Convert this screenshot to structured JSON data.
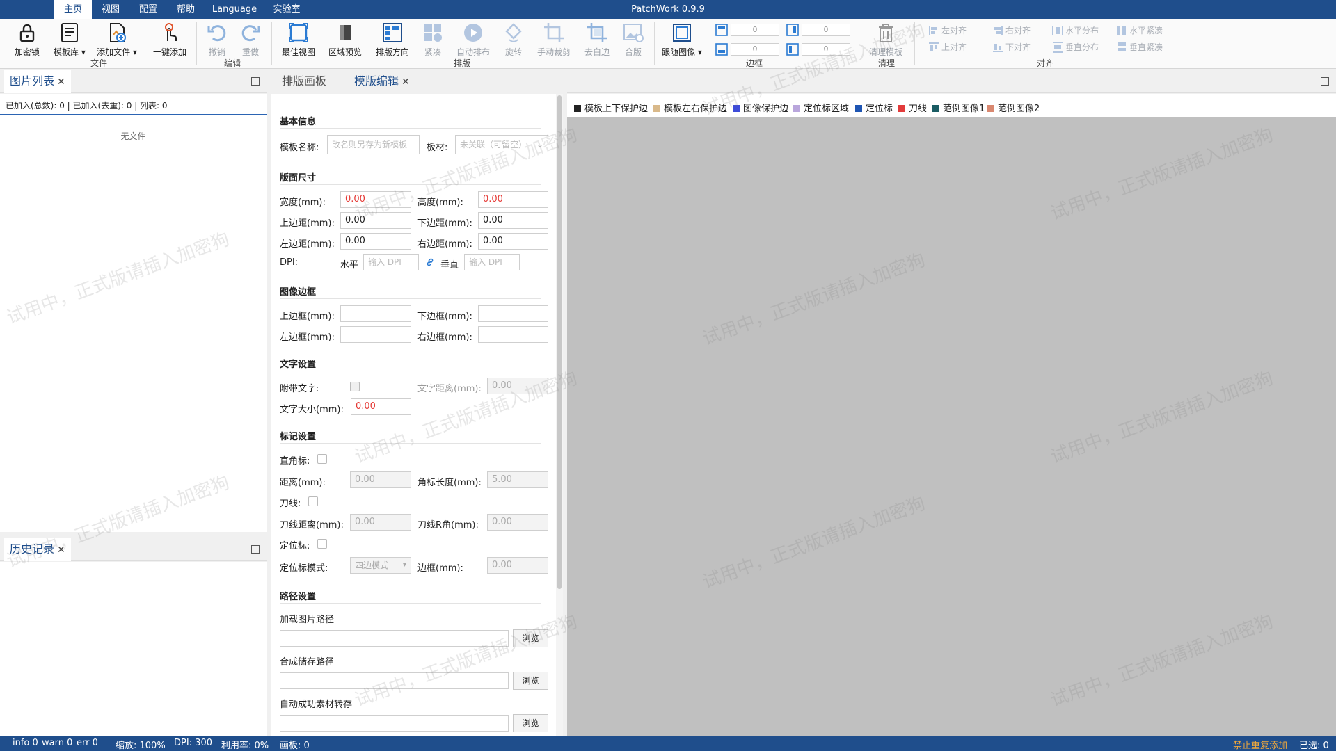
{
  "menu": {
    "tabs": [
      "主页",
      "视图",
      "配置",
      "帮助",
      "Language",
      "实验室"
    ],
    "title": "PatchWork 0.9.9"
  },
  "ribbon": {
    "file": {
      "lock": "加密锁",
      "templates": "模板库",
      "add_file": "添加文件",
      "one_click": "一键添加",
      "group": "文件"
    },
    "edit": {
      "undo": "撤销",
      "redo": "重做",
      "group": "编辑"
    },
    "layout": {
      "best_view": "最佳视图",
      "area_preview": "区域预览",
      "direction": "排版方向",
      "compact": "紧凑",
      "auto": "自动排布",
      "rotate": "旋转",
      "crop": "手动裁剪",
      "trim": "去白边",
      "merge": "合版",
      "group": "排版"
    },
    "border": {
      "follow": "跟随图像",
      "v1": "0",
      "v2": "0",
      "v3": "0",
      "v4": "0",
      "group": "边框"
    },
    "clean": {
      "label": "清理模板",
      "group": "清理"
    },
    "align": {
      "left": "左对齐",
      "right": "右对齐",
      "hdist": "水平分布",
      "hcompact": "水平紧凑",
      "top": "上对齐",
      "bottom": "下对齐",
      "vdist": "垂直分布",
      "vcompact": "垂直紧凑",
      "group": "对齐"
    }
  },
  "image_list": {
    "tab": "图片列表",
    "summary": "已加入(总数): 0 | 已加入(去重): 0 | 列表: 0",
    "empty": "无文件"
  },
  "history": {
    "tab": "历史记录"
  },
  "center_tabs": {
    "canvas": "排版画板",
    "editor": "模版编辑"
  },
  "form": {
    "basic": {
      "title": "基本信息",
      "name_label": "模板名称:",
      "name_ph": "改名则另存为新模板",
      "material_label": "板材:",
      "material_ph": "未关联（可留空）"
    },
    "size": {
      "title": "版面尺寸",
      "width_label": "宽度(mm):",
      "width": "0.00",
      "height_label": "高度(mm):",
      "height": "0.00",
      "top_label": "上边距(mm):",
      "top": "0.00",
      "bottom_label": "下边距(mm):",
      "bottom": "0.00",
      "left_label": "左边距(mm):",
      "left": "0.00",
      "right_label": "右边距(mm):",
      "right": "0.00",
      "dpi_label": "DPI:",
      "h_label": "水平",
      "h_ph": "输入 DPI",
      "v_label": "垂直",
      "v_ph": "输入 DPI"
    },
    "border": {
      "title": "图像边框",
      "top_label": "上边框(mm):",
      "bottom_label": "下边框(mm):",
      "left_label": "左边框(mm):",
      "right_label": "右边框(mm):"
    },
    "text": {
      "title": "文字设置",
      "attach_label": "附带文字:",
      "dist_label": "文字距离(mm):",
      "dist": "0.00",
      "size_label": "文字大小(mm):",
      "size": "0.00"
    },
    "mark": {
      "title": "标记设置",
      "corner_label": "直角标:",
      "dist_label": "距离(mm):",
      "dist": "0.00",
      "len_label": "角标长度(mm):",
      "len": "5.00",
      "knife_label": "刀线:",
      "kdist_label": "刀线距离(mm):",
      "kdist": "0.00",
      "kr_label": "刀线R角(mm):",
      "kr": "0.00",
      "pos_label": "定位标:",
      "mode_label": "定位标模式:",
      "mode": "四边模式",
      "frame_label": "边框(mm):",
      "frame": "0.00"
    },
    "path": {
      "title": "路径设置",
      "load_label": "加载图片路径",
      "save_label": "合成储存路径",
      "auto_label": "自动成功素材转存",
      "browse": "浏览"
    }
  },
  "legend": [
    {
      "label": "模板上下保护边",
      "color": "#222222"
    },
    {
      "label": "模板左右保护边",
      "color": "#d9b98a"
    },
    {
      "label": "图像保护边",
      "color": "#3d4bd8"
    },
    {
      "label": "定位标区域",
      "color": "#b9a6dc"
    },
    {
      "label": "定位标",
      "color": "#1e55b3"
    },
    {
      "label": "刀线",
      "color": "#e23b3b"
    },
    {
      "label": "范例图像1",
      "color": "#1a5c63"
    },
    {
      "label": "范例图像2",
      "color": "#d98870"
    }
  ],
  "watermark": "试用中，正式版请插入加密狗",
  "status": {
    "info": "info 0",
    "warn": "warn 0",
    "err": "err 0",
    "zoom": "缩放: 100%",
    "dpi": "DPI: 300",
    "util": "利用率: 0%",
    "boards": "画板: 0",
    "dup": "禁止重复添加",
    "selected": "已选: 0"
  }
}
